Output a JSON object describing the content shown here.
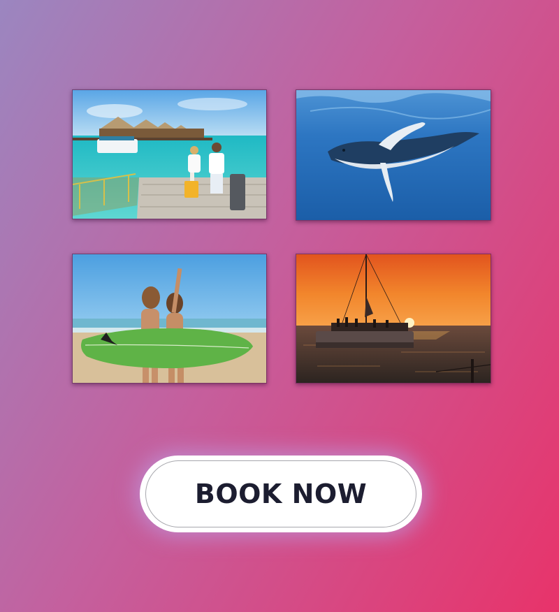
{
  "gallery": {
    "images": [
      {
        "icon": "tropical-resort-photo"
      },
      {
        "icon": "whale-photo"
      },
      {
        "icon": "surfers-photo"
      },
      {
        "icon": "sunset-catamaran-photo"
      }
    ]
  },
  "cta": {
    "label": "BOOK NOW"
  },
  "colors": {
    "background_start": "#9b86c0",
    "background_end": "#e8336a",
    "button_bg": "#ffffff",
    "button_text": "#1c1d30"
  }
}
